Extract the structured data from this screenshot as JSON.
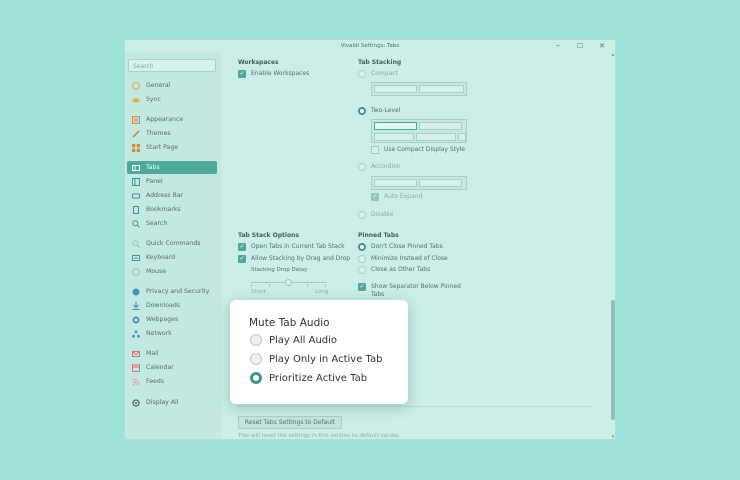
{
  "window": {
    "title": "Vivaldi Settings: Tabs",
    "minimize": "–",
    "maximize": "☐",
    "close": "✕"
  },
  "sidebar": {
    "search_placeholder": "Search",
    "items": [
      {
        "label": "General",
        "icon": "general-icon"
      },
      {
        "label": "Sync",
        "icon": "sync-icon"
      },
      {
        "label": "Appearance",
        "icon": "appearance-icon"
      },
      {
        "label": "Themes",
        "icon": "themes-icon"
      },
      {
        "label": "Start Page",
        "icon": "start-page-icon"
      },
      {
        "label": "Tabs",
        "icon": "tabs-icon"
      },
      {
        "label": "Panel",
        "icon": "panel-icon"
      },
      {
        "label": "Address Bar",
        "icon": "address-bar-icon"
      },
      {
        "label": "Bookmarks",
        "icon": "bookmarks-icon"
      },
      {
        "label": "Search",
        "icon": "search-icon"
      },
      {
        "label": "Quick Commands",
        "icon": "quick-commands-icon"
      },
      {
        "label": "Keyboard",
        "icon": "keyboard-icon"
      },
      {
        "label": "Mouse",
        "icon": "mouse-icon"
      },
      {
        "label": "Privacy and Security",
        "icon": "privacy-icon"
      },
      {
        "label": "Downloads",
        "icon": "downloads-icon"
      },
      {
        "label": "Webpages",
        "icon": "webpages-icon"
      },
      {
        "label": "Network",
        "icon": "network-icon"
      },
      {
        "label": "Mail",
        "icon": "mail-icon"
      },
      {
        "label": "Calendar",
        "icon": "calendar-icon"
      },
      {
        "label": "Feeds",
        "icon": "feeds-icon"
      },
      {
        "label": "Display All",
        "icon": "display-all-icon"
      }
    ],
    "active_item": "Tabs"
  },
  "workspaces": {
    "title": "Workspaces",
    "enable_label": "Enable Workspaces",
    "enable_checked": true
  },
  "tab_stacking": {
    "title": "Tab Stacking",
    "compact_label": "Compact",
    "two_level_label": "Two-Level",
    "use_compact_display_label": "Use Compact Display Style",
    "accordion_label": "Accordion",
    "auto_expand_label": "Auto Expand",
    "disable_label": "Disable",
    "selected": "Two-Level"
  },
  "tab_stack_options": {
    "title": "Tab Stack Options",
    "open_tabs_label": "Open Tabs in Current Tab Stack",
    "allow_stacking_label": "Allow Stacking by Drag and Drop",
    "stacking_drop_delay_label": "Stacking Drop Delay",
    "slider_min": "Short",
    "slider_max": "Long",
    "slider_value": 0.5
  },
  "pinned_tabs": {
    "title": "Pinned Tabs",
    "dont_close_label": "Don't Close Pinned Tabs",
    "minimize_label": "Minimize Instead of Close",
    "close_as_other_label": "Close as Other Tabs",
    "show_separator_label": "Show Separator Below Pinned Tabs",
    "selected": "Don't Close Pinned Tabs"
  },
  "footer": {
    "reset_button": "Reset Tabs Settings to Default",
    "reset_note": "This will reset the settings in this section to default values."
  },
  "popup": {
    "title": "Mute Tab Audio",
    "options": [
      "Play All Audio",
      "Play Only in Active Tab",
      "Prioritize Active Tab"
    ],
    "selected": "Prioritize Active Tab"
  },
  "colors": {
    "accent": "#4fa899",
    "background": "#9ee3d7",
    "window": "#cdeee8"
  }
}
